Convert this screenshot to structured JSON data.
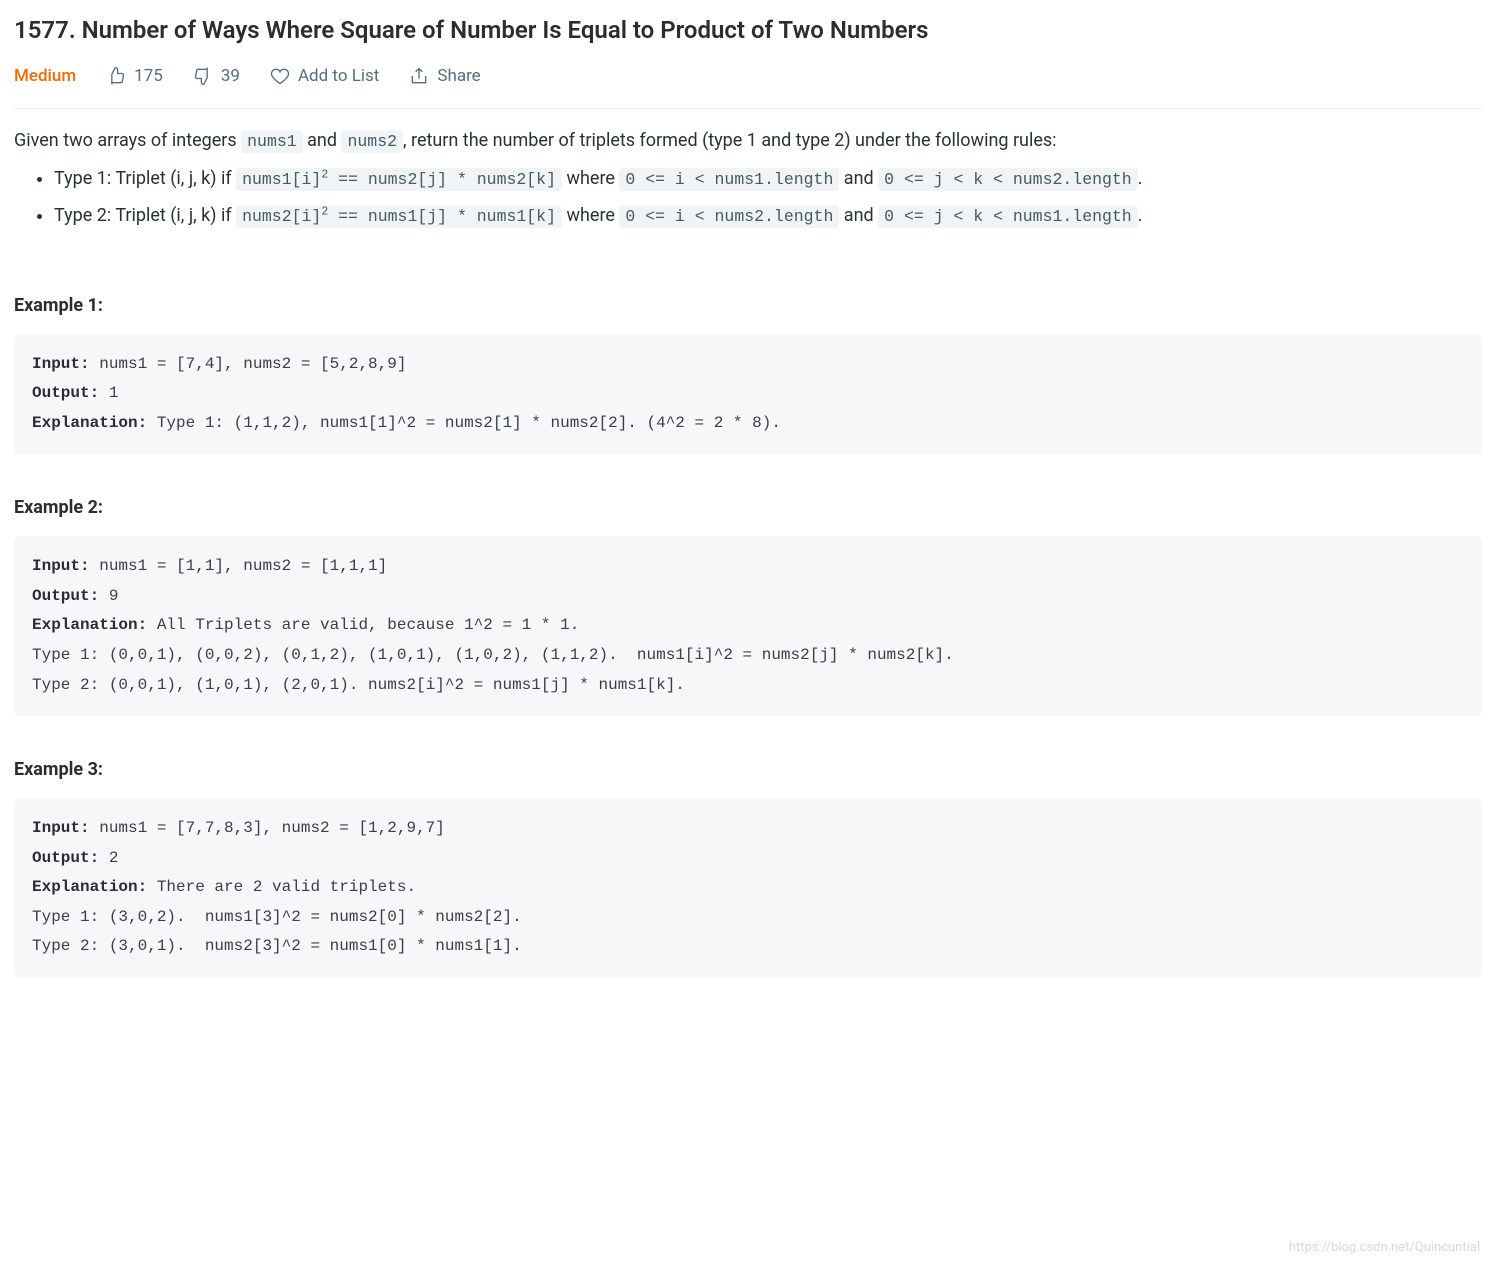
{
  "title": "1577. Number of Ways Where Square of Number Is Equal to Product of Two Numbers",
  "meta": {
    "difficulty": "Medium",
    "likes": "175",
    "dislikes": "39",
    "add_to_list": "Add to List",
    "share": "Share"
  },
  "desc": {
    "intro_before_nums1": "Given two arrays of integers ",
    "nums1": "nums1",
    "intro_between": " and ",
    "nums2": "nums2",
    "intro_after": ", return the number of triplets formed (type 1 and type 2) under the following rules:",
    "type1": {
      "pre": "Type 1: Triplet (i, j, k) if ",
      "c1a": "nums1[i]",
      "c1b": " == nums2[j] * nums2[k]",
      "mid": " where ",
      "c2": "0 <= i < nums1.length",
      "and": " and ",
      "c3": "0 <= j < k < nums2.length",
      "dot": "."
    },
    "type2": {
      "pre": "Type 2: Triplet (i, j, k) if ",
      "c1a": "nums2[i]",
      "c1b": " == nums1[j] * nums1[k]",
      "mid": " where ",
      "c2": "0 <= i < nums2.length",
      "and": " and ",
      "c3": "0 <= j < k < nums1.length",
      "dot": "."
    }
  },
  "examples": {
    "e1": {
      "heading": "Example 1:",
      "input_label": "Input:",
      "input_val": " nums1 = [7,4], nums2 = [5,2,8,9]",
      "output_label": "Output:",
      "output_val": " 1",
      "expl_label": "Explanation:",
      "expl_val": " Type 1: (1,1,2), nums1[1]^2 = nums2[1] * nums2[2]. (4^2 = 2 * 8)."
    },
    "e2": {
      "heading": "Example 2:",
      "input_label": "Input:",
      "input_val": " nums1 = [1,1], nums2 = [1,1,1]",
      "output_label": "Output:",
      "output_val": " 9",
      "expl_label": "Explanation:",
      "expl_line1": " All Triplets are valid, because 1^2 = 1 * 1.",
      "expl_line2": "Type 1: (0,0,1), (0,0,2), (0,1,2), (1,0,1), (1,0,2), (1,1,2).  nums1[i]^2 = nums2[j] * nums2[k].",
      "expl_line3": "Type 2: (0,0,1), (1,0,1), (2,0,1). nums2[i]^2 = nums1[j] * nums1[k]."
    },
    "e3": {
      "heading": "Example 3:",
      "input_label": "Input:",
      "input_val": " nums1 = [7,7,8,3], nums2 = [1,2,9,7]",
      "output_label": "Output:",
      "output_val": " 2",
      "expl_label": "Explanation:",
      "expl_line1": " There are 2 valid triplets.",
      "expl_line2": "Type 1: (3,0,2).  nums1[3]^2 = nums2[0] * nums2[2].",
      "expl_line3": "Type 2: (3,0,1).  nums2[3]^2 = nums1[0] * nums1[1]."
    }
  },
  "watermark": "https://blog.csdn.net/Quincuntial"
}
